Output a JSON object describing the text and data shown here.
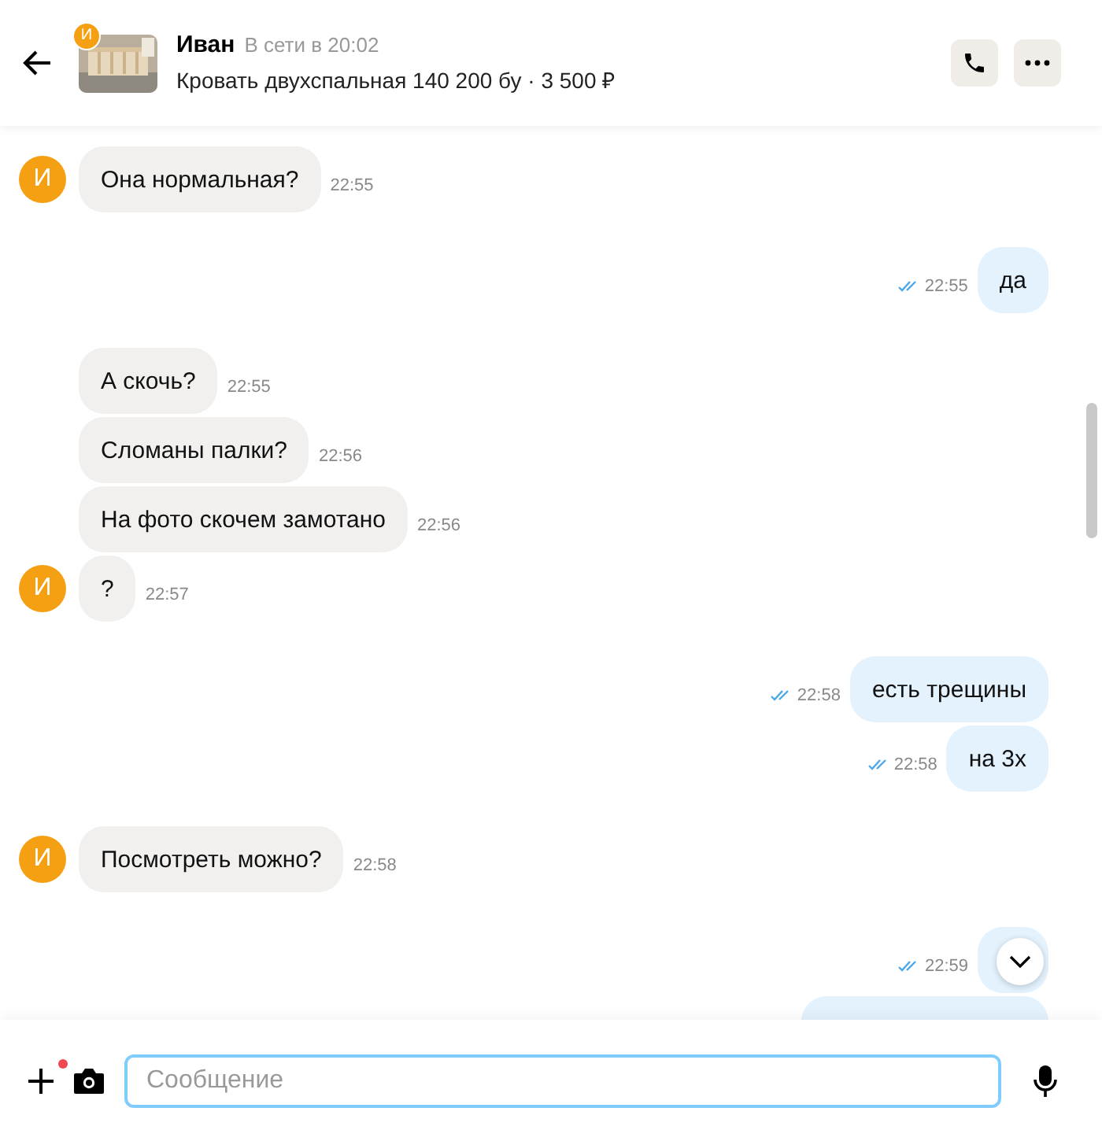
{
  "header": {
    "name": "Иван",
    "status": "В сети в 20:02",
    "avatar": "И",
    "listing": "Кровать двухспальная 140 200 бу · 3 500 ₽"
  },
  "groups": [
    {
      "kind": "incoming",
      "avatar": "И",
      "messages": [
        {
          "kind": "text",
          "text": "Она нормальная?",
          "time": "22:55"
        }
      ]
    },
    {
      "kind": "outgoing",
      "messages": [
        {
          "kind": "text",
          "text": "да",
          "time": "22:55",
          "read": true
        }
      ]
    },
    {
      "kind": "incoming",
      "avatar": "И",
      "messages": [
        {
          "kind": "text",
          "text": "А скочь?",
          "time": "22:55"
        },
        {
          "kind": "text",
          "text": "Сломаны палки?",
          "time": "22:56"
        },
        {
          "kind": "text",
          "text": "На фото скочем замотано",
          "time": "22:56"
        },
        {
          "kind": "text",
          "text": "?",
          "time": "22:57"
        }
      ]
    },
    {
      "kind": "outgoing",
      "messages": [
        {
          "kind": "text",
          "text": "есть трещины",
          "time": "22:58",
          "read": true
        },
        {
          "kind": "text",
          "text": "на 3х",
          "time": "22:58",
          "read": true
        }
      ]
    },
    {
      "kind": "incoming",
      "avatar": "И",
      "messages": [
        {
          "kind": "text",
          "text": "Посмотреть можно?",
          "time": "22:58"
        }
      ]
    },
    {
      "kind": "outgoing",
      "messages": [
        {
          "kind": "covered",
          "time": "22:59",
          "read": true
        },
        {
          "kind": "cut"
        }
      ]
    }
  ],
  "composer": {
    "placeholder": "Сообщение",
    "attach_badge": true
  }
}
